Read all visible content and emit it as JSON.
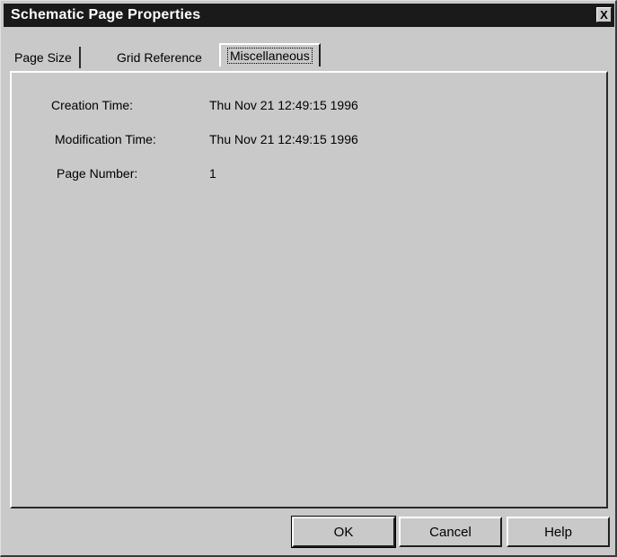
{
  "window": {
    "title": "Schematic Page Properties",
    "close_label": "X"
  },
  "tabs": [
    {
      "label": "Page Size",
      "active": false
    },
    {
      "label": "Grid Reference",
      "active": false
    },
    {
      "label": "Miscellaneous",
      "active": true
    }
  ],
  "misc": {
    "creation_label": "Creation Time:",
    "creation_value": "Thu Nov 21 12:49:15 1996",
    "modification_label": "Modification Time:",
    "modification_value": "Thu Nov 21 12:49:15 1996",
    "page_number_label": "Page Number:",
    "page_number_value": "1"
  },
  "buttons": {
    "ok": "OK",
    "cancel": "Cancel",
    "help": "Help"
  }
}
